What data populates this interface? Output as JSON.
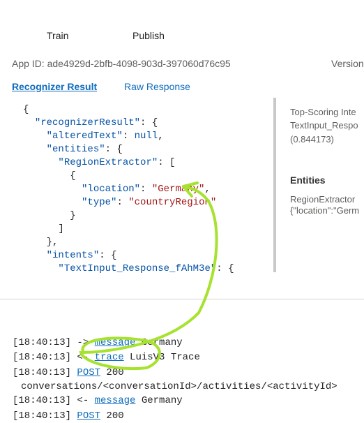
{
  "nav": {
    "train": "Train",
    "publish": "Publish"
  },
  "app_id": "App ID: ade4929d-2bfb-4098-903d-397060d76c95",
  "version_label": "Version",
  "tabs": {
    "recognizer": "Recognizer Result",
    "raw": "Raw Response"
  },
  "json_lines": {
    "l1": "{",
    "l2_key": "\"recognizerResult\"",
    "l2_rest": ": {",
    "l3_key": "\"alteredText\"",
    "l3_colon": ": ",
    "l3_val": "null",
    "l3_end": ",",
    "l4_key": "\"entities\"",
    "l4_rest": ": {",
    "l5_key": "\"RegionExtractor\"",
    "l5_rest": ": [",
    "l6": "{",
    "l7_key": "\"location\"",
    "l7_colon": ": ",
    "l7_val": "\"Germany\"",
    "l7_end": ",",
    "l8_key": "\"type\"",
    "l8_colon": ": ",
    "l8_val": "\"countryRegion\"",
    "l9": "}",
    "l10": "]",
    "l11": "},",
    "l12_key": "\"intents\"",
    "l12_rest": ": {",
    "l13_key": "\"TextInput_Response_fAhM3e\"",
    "l13_rest": ": {"
  },
  "side": {
    "top_scoring": "Top-Scoring Inte",
    "intent_name": "TextInput_Respo",
    "score": "(0.844173)",
    "entities_heading": "Entities",
    "entity_name": "RegionExtractor",
    "entity_value": "{\"location\":\"Germ"
  },
  "log": [
    {
      "time": "[18:40:13]",
      "arrow": " -> ",
      "link": "message",
      "text": " Germany"
    },
    {
      "time": "[18:40:13]",
      "arrow": " <- ",
      "link": "trace",
      "text": " LuisV3 Trace"
    },
    {
      "time": "[18:40:13]",
      "arrow": " ",
      "link": "POST",
      "text": " 200"
    },
    {
      "path": "conversations/<conversationId>/activities/<activityId>"
    },
    {
      "time": "[18:40:13]",
      "arrow": " <- ",
      "link": "message",
      "text": " Germany"
    },
    {
      "time": "[18:40:13]",
      "arrow": " ",
      "link": "POST",
      "text": " 200"
    }
  ],
  "colors": {
    "accent": "#0f6cbd",
    "annotation": "#a6e22e"
  }
}
